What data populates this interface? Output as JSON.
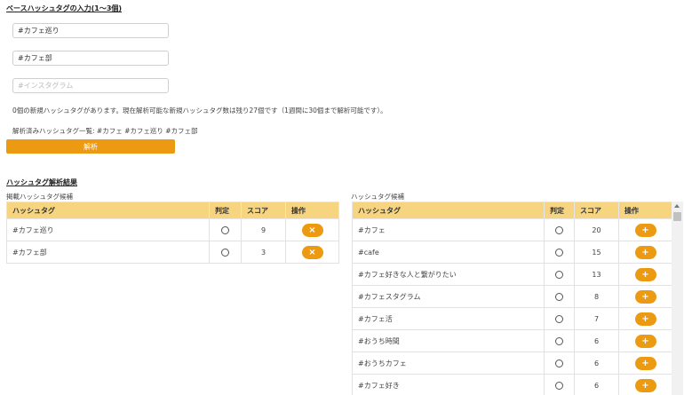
{
  "input_section": {
    "title": "ベースハッシュタグの入力(1〜3個)",
    "fields": [
      {
        "value": "#カフェ巡り",
        "placeholder": ""
      },
      {
        "value": "#カフェ部",
        "placeholder": ""
      },
      {
        "value": "",
        "placeholder": "#インスタグラム"
      }
    ],
    "info_text": "0個の新規ハッシュタグがあります。現在解析可能な新規ハッシュタグ数は残り27個です（1週間に30個まで解析可能です）。",
    "analyzed_text": "解析済みハッシュタグ一覧: #カフェ #カフェ巡り #カフェ部",
    "analyze_label": "解析"
  },
  "results_section": {
    "title": "ハッシュタグ解析結果",
    "posted": {
      "label": "掲載ハッシュタグ候補",
      "columns": [
        "ハッシュタグ",
        "判定",
        "スコア",
        "操作"
      ],
      "rows": [
        {
          "tag": "#カフェ巡り",
          "score": "9",
          "action": "×"
        },
        {
          "tag": "#カフェ部",
          "score": "3",
          "action": "×"
        }
      ]
    },
    "candidates": {
      "label": "ハッシュタグ候補",
      "columns": [
        "ハッシュタグ",
        "判定",
        "スコア",
        "操作"
      ],
      "rows": [
        {
          "tag": "#カフェ",
          "score": "20",
          "action": "+"
        },
        {
          "tag": "#cafe",
          "score": "15",
          "action": "+"
        },
        {
          "tag": "#カフェ好きな人と繋がりたい",
          "score": "13",
          "action": "+"
        },
        {
          "tag": "#カフェスタグラム",
          "score": "8",
          "action": "+"
        },
        {
          "tag": "#カフェ活",
          "score": "7",
          "action": "+"
        },
        {
          "tag": "#おうち時間",
          "score": "6",
          "action": "+"
        },
        {
          "tag": "#おうちカフェ",
          "score": "6",
          "action": "+"
        },
        {
          "tag": "#カフェ好き",
          "score": "6",
          "action": "+"
        }
      ]
    }
  },
  "colors": {
    "accent": "#ec9a12",
    "table_header": "#f7d580"
  }
}
